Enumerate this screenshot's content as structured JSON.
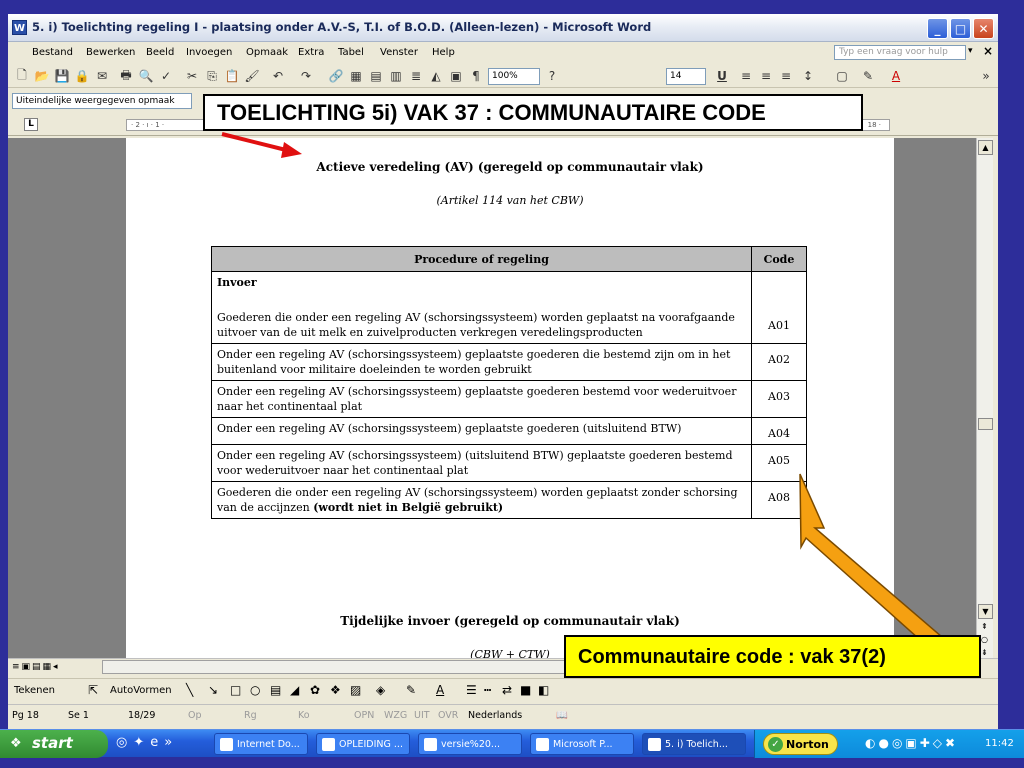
{
  "window": {
    "title": "5. i) Toelichting regeling I - plaatsing onder A.V.-S, T.I. of B.O.D.      (Alleen-lezen) - Microsoft Word",
    "app_icon": "word-document-icon"
  },
  "menu": {
    "items": [
      "Bestand",
      "Bewerken",
      "Beeld",
      "Invoegen",
      "Opmaak",
      "Extra",
      "Tabel",
      "Venster",
      "Help"
    ],
    "ask_placeholder": "Typ een vraag voor hulp",
    "close_label": "×"
  },
  "toolbar": {
    "zoom": "100%",
    "font_size": "14",
    "underline": "U"
  },
  "style_box": "Uiteindelijke weergegeven opmaak",
  "ruler": {
    "left_marks": "· 2 · ı · 1 ·",
    "right_mark": "18 ·"
  },
  "document": {
    "heading_1": "Actieve veredeling (AV) (geregeld op communautair vlak)",
    "subtitle_1": "(Artikel 114 van het CBW)",
    "table": {
      "headers": [
        "Procedure of regeling",
        "Code"
      ],
      "rows": [
        {
          "section": "Invoer",
          "text": "Goederen die onder een regeling AV (schorsingssysteem) worden geplaatst na voorafgaande uitvoer van de uit melk en zuivelproducten verkregen veredelingsproducten",
          "code": "A01"
        },
        {
          "text": "Onder een regeling AV (schorsingssysteem) geplaatste goederen die bestemd zijn om in het buitenland voor militaire doeleinden te worden gebruikt",
          "code": "A02"
        },
        {
          "text": "Onder een regeling AV (schorsingssysteem) geplaatste goederen bestemd voor wederuitvoer naar het continentaal plat",
          "code": "A03"
        },
        {
          "text": "Onder een regeling AV (schorsingssysteem) geplaatste goederen (uitsluitend BTW)",
          "code": "A04"
        },
        {
          "text": "Onder een regeling AV (schorsingssysteem) (uitsluitend BTW) geplaatste goederen bestemd voor wederuitvoer naar het continentaal plat",
          "code": "A05"
        },
        {
          "text": "Goederen die onder een regeling AV (schorsingssysteem) worden geplaatst zonder schorsing van de accijnzen",
          "text_bold": "(wordt niet in België gebruikt)",
          "code": "A08"
        }
      ]
    },
    "heading_2": "Tijdelijke invoer (geregeld op communautair vlak)",
    "subtitle_2": "(CBW + CTW)"
  },
  "drawing_toolbar": {
    "draw_label": "Tekenen",
    "autoshapes_label": "AutoVormen"
  },
  "statusbar": {
    "page": "Pg 18",
    "section": "Se 1",
    "pages": "18/29",
    "at": "Op",
    "line": "Rg",
    "column": "Ko",
    "rec": "OPN",
    "trk": "WZG",
    "ext": "UIT",
    "ovr": "OVR",
    "language": "Nederlands"
  },
  "taskbar": {
    "start_label": "start",
    "tasks": [
      "Internet Do...",
      "OPLEIDING ...",
      "versie%20...",
      "Microsoft P...",
      "5. i) Toelich..."
    ],
    "norton_label": "Norton",
    "clock": "11:42"
  },
  "annotations": {
    "top_callout": "TOELICHTING 5i) VAK 37 : COMMUNAUTAIRE CODE",
    "bottom_callout": "Communautaire code : vak 37(2)"
  },
  "colors": {
    "slide_background": "#2d2d9a",
    "arrow_red": "#e01010",
    "arrow_orange": "#f5a011",
    "callout_yellow": "#ffff00",
    "table_header_gray": "#bdbdbd"
  }
}
